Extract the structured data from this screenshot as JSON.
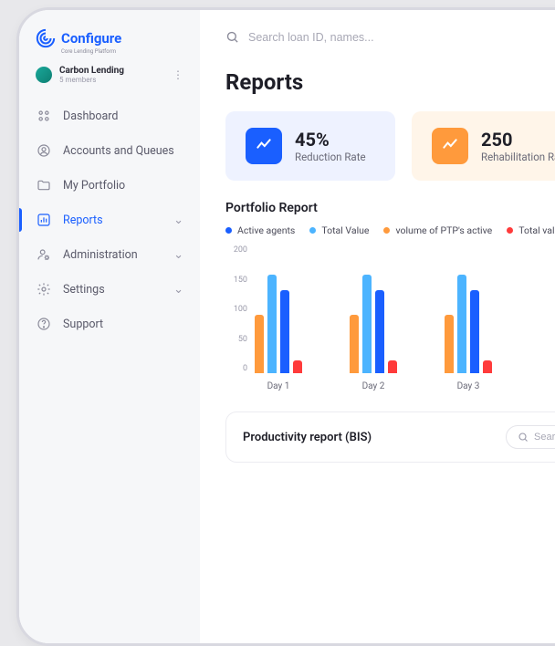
{
  "brand": {
    "name": "Configure",
    "tagline": "Core Lending Platform"
  },
  "org": {
    "name": "Carbon Lending",
    "members": "5 members"
  },
  "nav": [
    {
      "id": "dashboard",
      "label": "Dashboard",
      "icon": "grid"
    },
    {
      "id": "accounts",
      "label": "Accounts and Queues",
      "icon": "user-circle"
    },
    {
      "id": "portfolio",
      "label": "My Portfolio",
      "icon": "folder"
    },
    {
      "id": "reports",
      "label": "Reports",
      "icon": "chart",
      "active": true,
      "expandable": true
    },
    {
      "id": "admin",
      "label": "Administration",
      "icon": "user-cog",
      "expandable": true
    },
    {
      "id": "settings",
      "label": "Settings",
      "icon": "gear",
      "expandable": true
    },
    {
      "id": "support",
      "label": "Support",
      "icon": "help"
    }
  ],
  "search": {
    "placeholder": "Search loan ID, names..."
  },
  "page": {
    "title": "Reports"
  },
  "kpis": [
    {
      "id": "reduction",
      "value": "45%",
      "label": "Reduction Rate",
      "variant": "blue"
    },
    {
      "id": "rehab",
      "value": "250",
      "label": "Rehabilitation Rate",
      "variant": "orange"
    }
  ],
  "portfolio_report": {
    "title": "Portfolio Report",
    "legend": [
      {
        "label": "Active agents",
        "color": "#1a5fff"
      },
      {
        "label": "Total Value",
        "color": "#4cb4ff"
      },
      {
        "label": "volume of PTP's active",
        "color": "#ff9a3c"
      },
      {
        "label": "Total value",
        "color": "#ff3b3b"
      }
    ]
  },
  "chart_data": {
    "type": "bar",
    "ylim": [
      0,
      200
    ],
    "yticks": [
      200,
      150,
      100,
      50,
      0
    ],
    "categories": [
      "Day 1",
      "Day 2",
      "Day 3"
    ],
    "series": [
      {
        "name": "volume of PTP's active",
        "color": "#ff9a3c",
        "values": [
          92,
          92,
          92
        ]
      },
      {
        "name": "Total Value",
        "color": "#4cb4ff",
        "values": [
          155,
          155,
          155
        ]
      },
      {
        "name": "Active agents",
        "color": "#1a5fff",
        "values": [
          130,
          130,
          130
        ]
      },
      {
        "name": "Total value",
        "color": "#ff3b3b",
        "values": [
          20,
          20,
          20
        ]
      }
    ],
    "highlight_index": 2
  },
  "productivity": {
    "title": "Productivity report (BIS)",
    "search_placeholder": "Search"
  }
}
